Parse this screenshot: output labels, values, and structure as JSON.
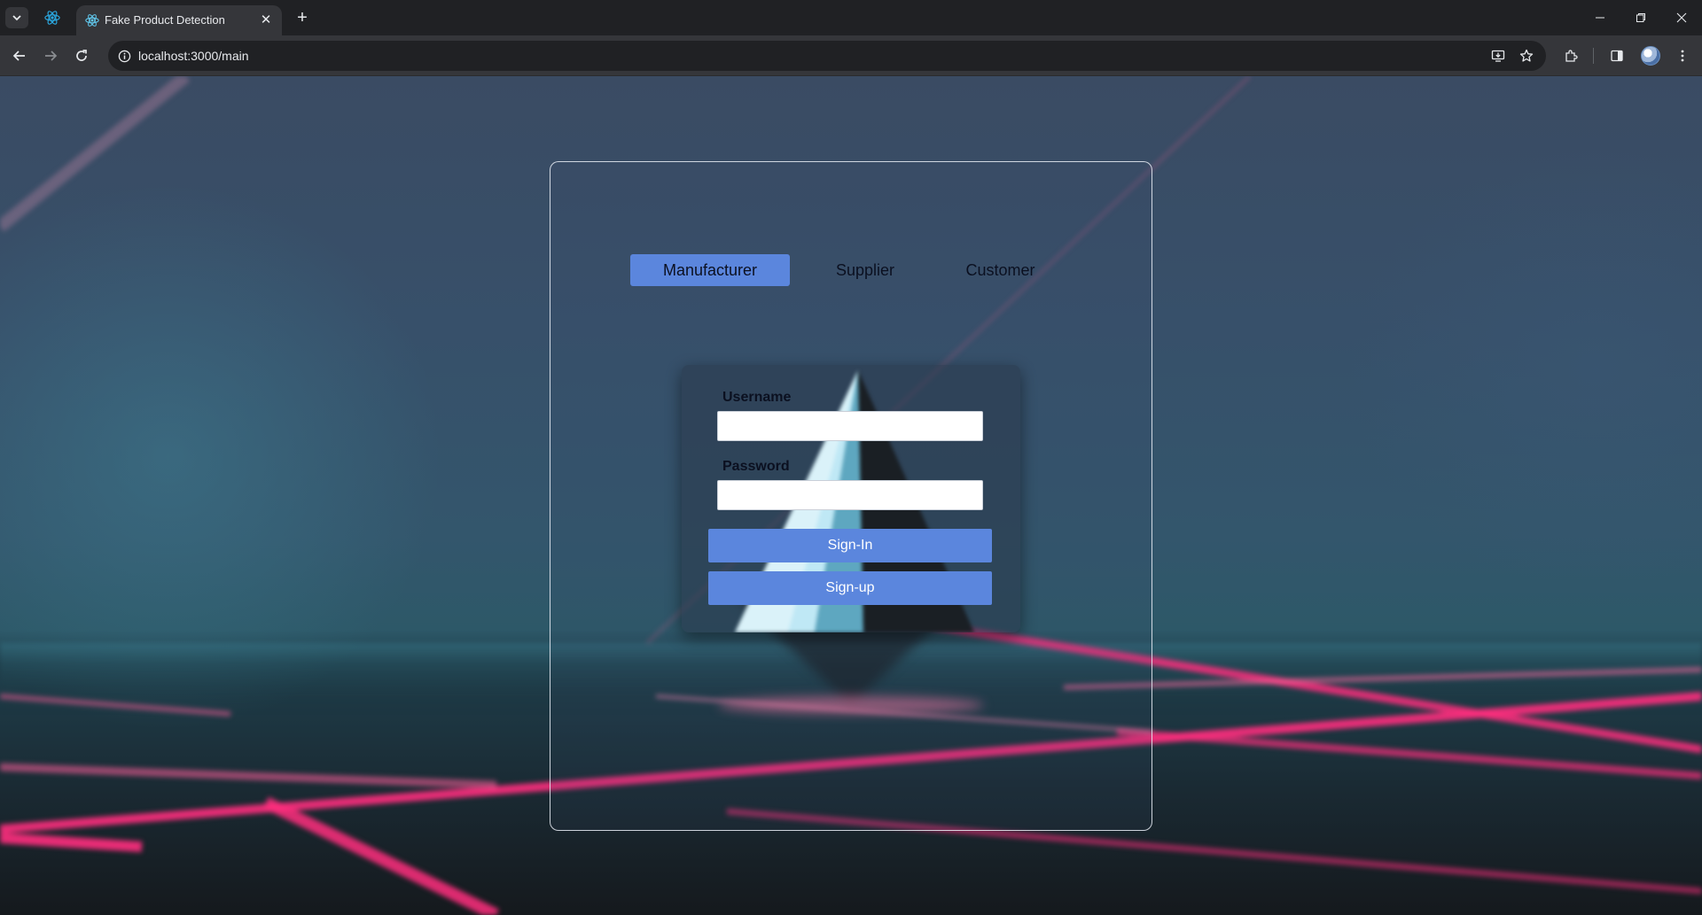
{
  "browser": {
    "tab_title": "Fake Product Detection",
    "tab_close": "✕",
    "new_tab": "+",
    "url": "localhost:3000/main",
    "icons": [
      "tab-search-icon",
      "react-icon",
      "back-arrow-icon",
      "forward-arrow-icon",
      "reload-icon",
      "info-icon",
      "install-app-icon",
      "star-icon",
      "extensions-icon",
      "side-panel-icon",
      "profile-avatar",
      "kebab-menu-icon",
      "minimize-icon",
      "restore-icon",
      "close-icon"
    ]
  },
  "page": {
    "role_tabs": [
      {
        "label": "Manufacturer",
        "active": true
      },
      {
        "label": "Supplier",
        "active": false
      },
      {
        "label": "Customer",
        "active": false
      }
    ],
    "form": {
      "username_label": "Username",
      "username_value": "",
      "password_label": "Password",
      "password_value": "",
      "signin_label": "Sign-In",
      "signup_label": "Sign-up"
    }
  },
  "colors": {
    "accent": "#5b86dd",
    "beam": "#ff2e7e",
    "card_border": "#ebf0f8"
  }
}
